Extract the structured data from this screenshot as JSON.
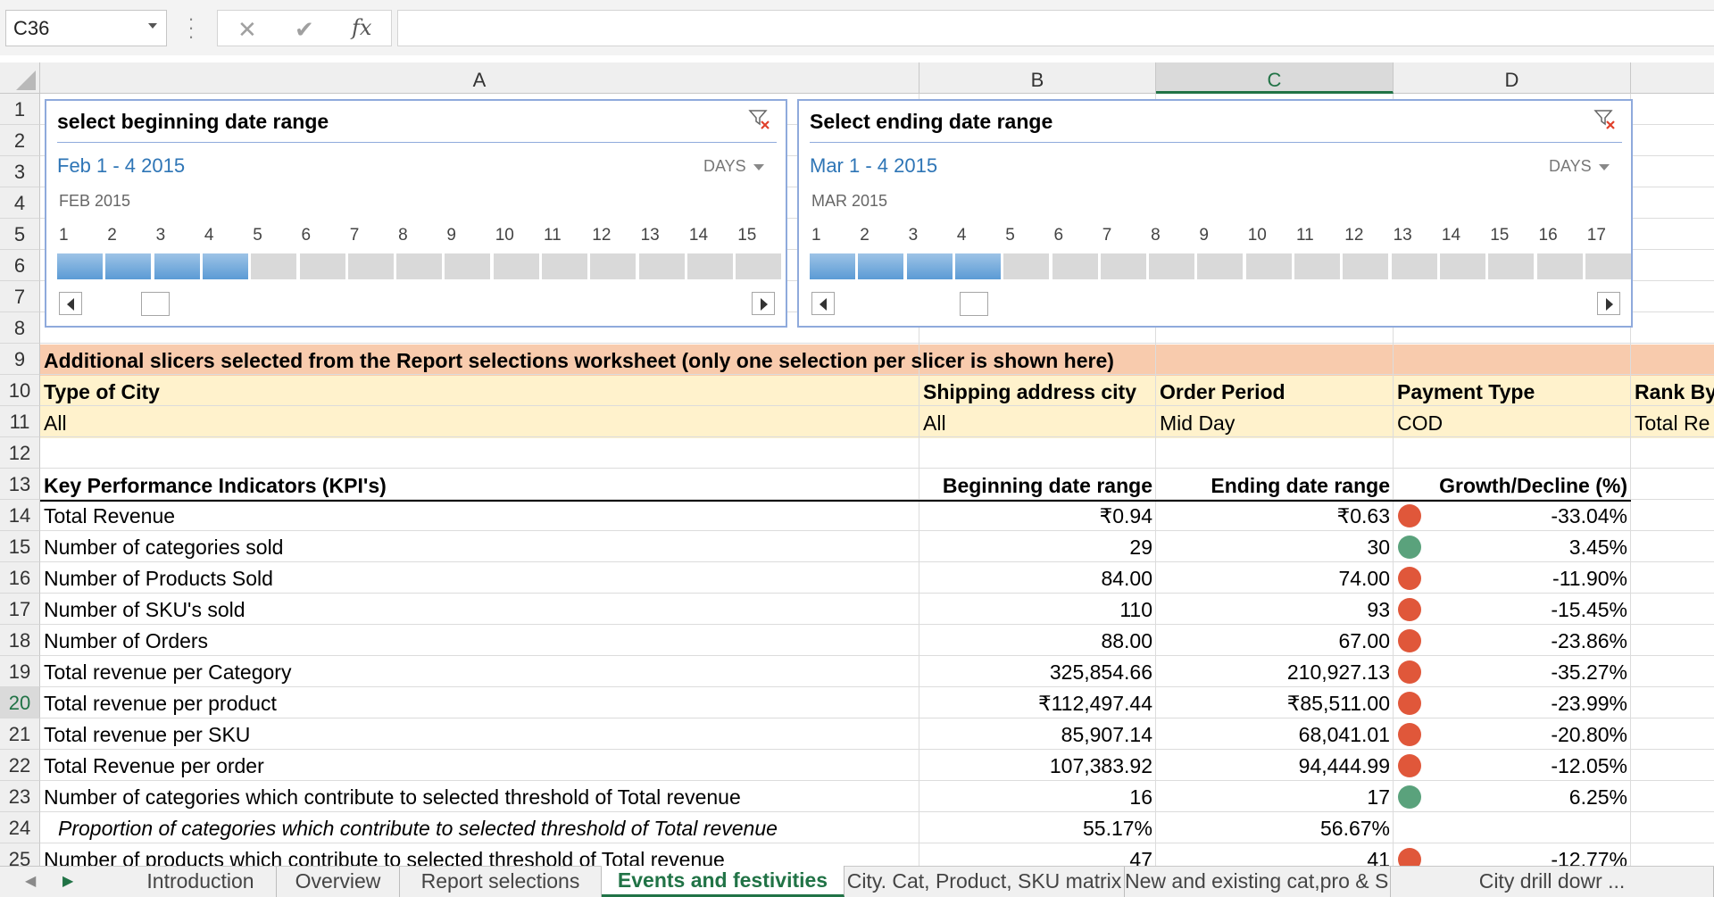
{
  "formula_bar": {
    "name_box": "C36",
    "cancel_icon": "✕",
    "enter_icon": "✔",
    "fx_label": "fx",
    "formula": ""
  },
  "columns": [
    "A",
    "B",
    "C",
    "D"
  ],
  "selected_column": "C",
  "rows": [
    "1",
    "2",
    "3",
    "4",
    "5",
    "6",
    "7",
    "8",
    "9",
    "10",
    "11",
    "12",
    "13",
    "14",
    "15",
    "16",
    "17",
    "18",
    "19",
    "20",
    "21",
    "22",
    "23",
    "24",
    "25"
  ],
  "selected_row": "20",
  "slicer_begin": {
    "title": "select beginning date range",
    "range": "Feb 1 - 4 2015",
    "level": "DAYS",
    "month": "FEB 2015",
    "days": [
      "1",
      "2",
      "3",
      "4",
      "5",
      "6",
      "7",
      "8",
      "9",
      "10",
      "11",
      "12",
      "13",
      "14",
      "15"
    ],
    "selected_count": 4
  },
  "slicer_end": {
    "title": "Select ending date range",
    "range": "Mar 1 - 4 2015",
    "level": "DAYS",
    "month": "MAR 2015",
    "days": [
      "1",
      "2",
      "3",
      "4",
      "5",
      "6",
      "7",
      "8",
      "9",
      "10",
      "11",
      "12",
      "13",
      "14",
      "15",
      "16",
      "17"
    ],
    "selected_count": 4
  },
  "banner": "Additional slicers selected from the Report selections worksheet (only one selection per slicer is shown here)",
  "filters": {
    "headers": [
      "Type of City",
      "Shipping address city",
      "Order Period",
      "Payment Type",
      "Rank By"
    ],
    "values": [
      "All",
      "All",
      "Mid Day",
      "COD",
      "Total Re"
    ]
  },
  "kpi_header": {
    "label": "Key Performance Indicators (KPI's)",
    "begin": "Beginning date range",
    "end": "Ending date range",
    "growth": "Growth/Decline (%)"
  },
  "kpis": [
    {
      "label": "Total Revenue",
      "begin": "₹0.94",
      "end": "₹0.63",
      "status": "down",
      "growth": "-33.04%"
    },
    {
      "label": "Number of categories sold",
      "begin": "29",
      "end": "30",
      "status": "up",
      "growth": "3.45%"
    },
    {
      "label": "Number of Products Sold",
      "begin": "84.00",
      "end": "74.00",
      "status": "down",
      "growth": "-11.90%"
    },
    {
      "label": "Number of SKU's sold",
      "begin": "110",
      "end": "93",
      "status": "down",
      "growth": "-15.45%"
    },
    {
      "label": "Number of Orders",
      "begin": "88.00",
      "end": "67.00",
      "status": "down",
      "growth": "-23.86%"
    },
    {
      "label": "Total revenue per Category",
      "begin": "325,854.66",
      "end": "210,927.13",
      "status": "down",
      "growth": "-35.27%"
    },
    {
      "label": "Total revenue per product",
      "begin": "₹112,497.44",
      "end": "₹85,511.00",
      "status": "down",
      "growth": "-23.99%"
    },
    {
      "label": "Total revenue per SKU",
      "begin": "85,907.14",
      "end": "68,041.01",
      "status": "down",
      "growth": "-20.80%"
    },
    {
      "label": "Total Revenue per order",
      "begin": "107,383.92",
      "end": "94,444.99",
      "status": "down",
      "growth": "-12.05%"
    },
    {
      "label": "Number of categories which contribute to selected threshold of Total revenue",
      "begin": "16",
      "end": "17",
      "status": "up",
      "growth": "6.25%"
    },
    {
      "label": "Proportion of categories which contribute to selected threshold of Total revenue",
      "begin": "55.17%",
      "end": "56.67%",
      "status": "",
      "growth": "",
      "italic": true
    },
    {
      "label": "Number of products which contribute to selected threshold of Total revenue",
      "begin": "47",
      "end": "41",
      "status": "down",
      "growth": "-12.77%"
    }
  ],
  "status_colors": {
    "down": "#e0573a",
    "up": "#5aa27c"
  },
  "tabs": [
    "Introduction",
    "Overview",
    "Report selections",
    "Events and festivities",
    "City. Cat, Product, SKU matrix",
    "New and existing cat,pro & SKU",
    "City drill dowr ..."
  ],
  "active_tab": "Events and festivities"
}
